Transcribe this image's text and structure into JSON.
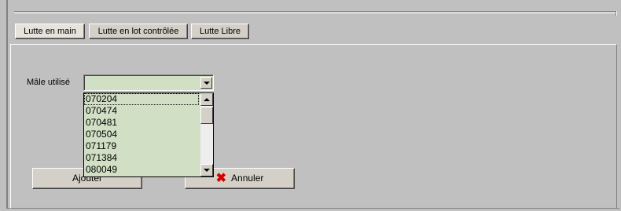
{
  "tabs": [
    {
      "label": "Lutte en main",
      "active": true
    },
    {
      "label": "Lutte en lot contrôlée",
      "active": false
    },
    {
      "label": "Lutte Libre",
      "active": false
    }
  ],
  "form": {
    "male_label": "Mâle utilisé",
    "male_value": ""
  },
  "dropdown": {
    "options": [
      "070204",
      "070474",
      "070481",
      "070504",
      "071179",
      "071384",
      "080049"
    ],
    "focused_index": 0
  },
  "buttons": {
    "add_label": "Ajouter",
    "cancel_label": "Annuler",
    "cancel_icon": "red-x-icon"
  },
  "colors": {
    "field_bg": "#d1dfc5",
    "window_bg": "#c0c0c0",
    "cancel_icon": "#d40000"
  }
}
